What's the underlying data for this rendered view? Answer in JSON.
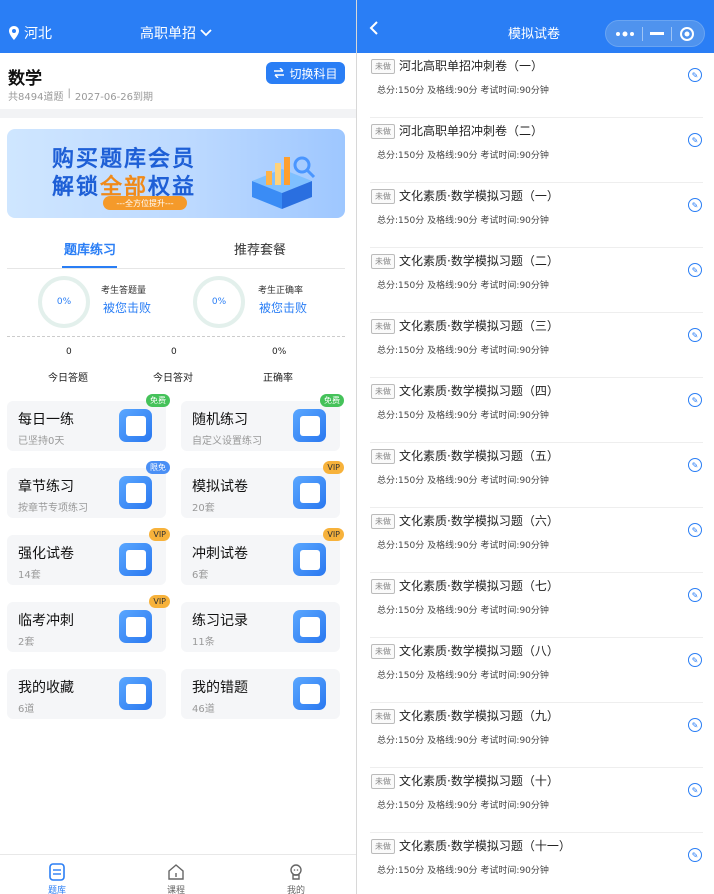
{
  "left": {
    "location": "河北",
    "mode": "高职单招",
    "subject": "数学",
    "question_count": "共8494道题",
    "expire": "2027-06-26到期",
    "switch_label": "切换科目",
    "banner": {
      "line1": "购买题库会员",
      "line2_a": "解锁",
      "line2_hl": "全部",
      "line2_b": "权益",
      "pill": "---全方位提升---"
    },
    "tabs": [
      "题库练习",
      "推荐套餐"
    ],
    "rings": [
      {
        "pct": "0%",
        "caption": "考生答题量",
        "link": "被您击败"
      },
      {
        "pct": "0%",
        "caption": "考生正确率",
        "link": "被您击败"
      }
    ],
    "stats": [
      {
        "value": "0",
        "label": "今日答题"
      },
      {
        "value": "0",
        "label": "今日答对"
      },
      {
        "value": "0%",
        "label": "正确率"
      }
    ],
    "cards": [
      {
        "title": "每日一练",
        "sub": "已坚持0天",
        "badge": "免费",
        "badge_type": "free",
        "icon": "calendar-icon"
      },
      {
        "title": "随机练习",
        "sub": "自定义设置练习",
        "badge": "免费",
        "badge_type": "free",
        "icon": "note-icon"
      },
      {
        "title": "章节练习",
        "sub": "按章节专项练习",
        "badge": "限免",
        "badge_type": "lim",
        "icon": "folder-icon"
      },
      {
        "title": "模拟试卷",
        "sub": "20套",
        "badge": "VIP",
        "badge_type": "vip",
        "icon": "edit-icon"
      },
      {
        "title": "强化试卷",
        "sub": "14套",
        "badge": "VIP",
        "badge_type": "vip",
        "icon": "edit-icon"
      },
      {
        "title": "冲刺试卷",
        "sub": "6套",
        "badge": "VIP",
        "badge_type": "vip",
        "icon": "edit-icon"
      },
      {
        "title": "临考冲刺",
        "sub": "2套",
        "badge": "VIP",
        "badge_type": "vip",
        "icon": "edit-icon"
      },
      {
        "title": "练习记录",
        "sub": "11条",
        "badge": "",
        "badge_type": "",
        "icon": "record-icon"
      },
      {
        "title": "我的收藏",
        "sub": "6道",
        "badge": "",
        "badge_type": "",
        "icon": "star-icon"
      },
      {
        "title": "我的错题",
        "sub": "46道",
        "badge": "",
        "badge_type": "",
        "icon": "error-book-icon"
      }
    ],
    "nav": [
      "题库",
      "课程",
      "我的"
    ]
  },
  "right": {
    "title": "模拟试卷",
    "exam_tag": "未做",
    "exams": [
      {
        "title": "河北高职单招冲刺卷（一）",
        "meta": "总分:150分  及格线:90分  考试时间:90分钟"
      },
      {
        "title": "河北高职单招冲刺卷（二）",
        "meta": "总分:150分  及格线:90分  考试时间:90分钟"
      },
      {
        "title": "文化素质·数学模拟习题（一）",
        "meta": "总分:150分  及格线:90分  考试时间:90分钟"
      },
      {
        "title": "文化素质·数学模拟习题（二）",
        "meta": "总分:150分  及格线:90分  考试时间:90分钟"
      },
      {
        "title": "文化素质·数学模拟习题（三）",
        "meta": "总分:150分  及格线:90分  考试时间:90分钟"
      },
      {
        "title": "文化素质·数学模拟习题（四）",
        "meta": "总分:150分  及格线:90分  考试时间:90分钟"
      },
      {
        "title": "文化素质·数学模拟习题（五）",
        "meta": "总分:150分  及格线:90分  考试时间:90分钟"
      },
      {
        "title": "文化素质·数学模拟习题（六）",
        "meta": "总分:150分  及格线:90分  考试时间:90分钟"
      },
      {
        "title": "文化素质·数学模拟习题（七）",
        "meta": "总分:150分  及格线:90分  考试时间:90分钟"
      },
      {
        "title": "文化素质·数学模拟习题（八）",
        "meta": "总分:150分  及格线:90分  考试时间:90分钟"
      },
      {
        "title": "文化素质·数学模拟习题（九）",
        "meta": "总分:150分  及格线:90分  考试时间:90分钟"
      },
      {
        "title": "文化素质·数学模拟习题（十）",
        "meta": "总分:150分  及格线:90分  考试时间:90分钟"
      },
      {
        "title": "文化素质·数学模拟习题（十一）",
        "meta": "总分:150分  及格线:90分  考试时间:90分钟"
      }
    ]
  }
}
